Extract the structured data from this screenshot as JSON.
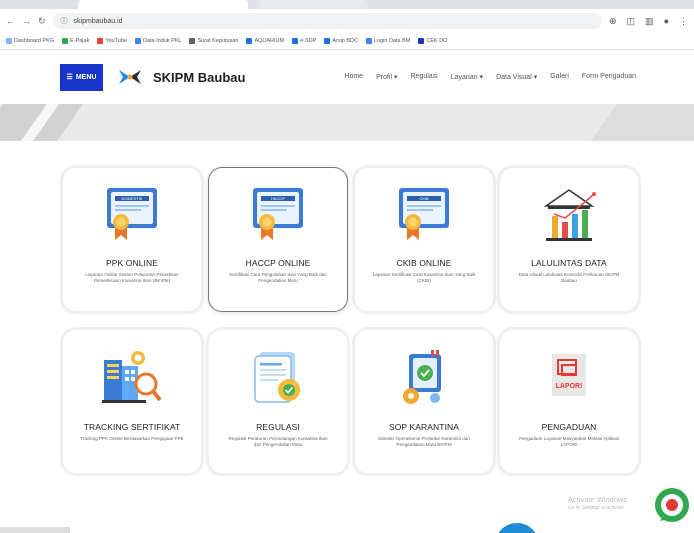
{
  "browser": {
    "address": "skipmbaubau.id",
    "bookmarks": [
      "Dashboard PKG",
      "E-Pajak",
      "YouTube",
      "Data Induk PKL",
      "Surat Keputusan",
      "AQUARIUM",
      "e-SDP",
      "Arsip BDC",
      "Login Data BM",
      "CEK DO"
    ]
  },
  "header": {
    "menu_label": "MENU",
    "brand": "SKIPM Baubau",
    "nav": [
      "Home",
      "Profil ▾",
      "Regulasi",
      "Layanan ▾",
      "Data Visual ▾",
      "Galeri",
      "Form Pengaduan"
    ]
  },
  "cards": [
    {
      "title": "PPK ONLINE",
      "desc": "Layanan Online Sistem Pelaporan Penerbitan Pemeriksaan Karantina Ikan (BKIPM)",
      "icon": "certificate-icon",
      "badge": "DOMESTIK"
    },
    {
      "title": "HACCP ONLINE",
      "desc": "Sertifikasi Cara Pengolahan Ikan Yang Baik dan Pengendalian Mutu",
      "icon": "certificate-icon",
      "badge": "HACCP"
    },
    {
      "title": "CKIB ONLINE",
      "desc": "Layanan Sertifikasi Cara Karantina Ikan Yang Baik (CKIB)",
      "icon": "certificate-icon",
      "badge": "CKIB"
    },
    {
      "title": "LALULINTAS DATA",
      "desc": "Data Visual Lalulintas Komoditi Perikanan SKIPM Baubau",
      "icon": "bar-chart-icon"
    },
    {
      "title": "TRACKING SERTIFIKAT",
      "desc": "Tracking PPK Online Berdasarkan Pengajuan PPK",
      "icon": "tracking-icon"
    },
    {
      "title": "REGULASI",
      "desc": "Regulasi Peraturan Perundangan Karantina Ikan dan Pengendalian Mutu",
      "icon": "regulation-document-icon"
    },
    {
      "title": "SOP KARANTINA",
      "desc": "Standar Operasional Prosedur Karantina dan Pengendalian Mutu BKIPM",
      "icon": "sop-document-icon"
    },
    {
      "title": "PENGADUAN",
      "desc": "Pengaduan Layanan Masyarakat Melalui Aplikasi LAPOR!",
      "icon": "complaint-icon",
      "badge": "LAPOR!"
    }
  ],
  "watermark": {
    "line1": "Activate Windows",
    "line2": "Go to Settings to activate"
  }
}
